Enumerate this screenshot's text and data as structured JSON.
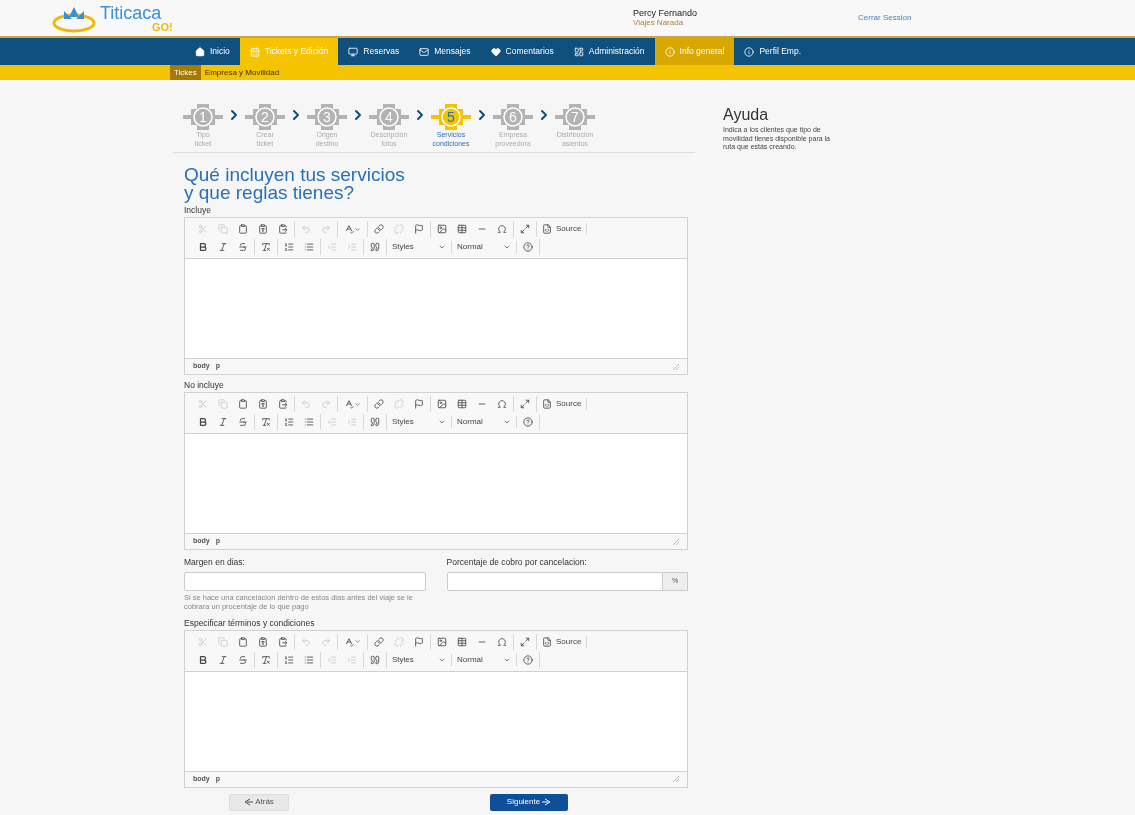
{
  "header": {
    "logo_text": "Titicaca",
    "logo_subtext": "GO!",
    "user_name": "Percy Fernando",
    "user_company": "Viajes Narada",
    "logout": "Cerrar Session"
  },
  "nav": [
    {
      "label": "Inicio",
      "kind": "home",
      "selected": false,
      "highlighted": false
    },
    {
      "label": "Tickets y Edición",
      "kind": "calendar",
      "selected": true,
      "highlighted": false
    },
    {
      "label": "Reservas",
      "kind": "reservas",
      "selected": false,
      "highlighted": false
    },
    {
      "label": "Mensajes",
      "kind": "mail",
      "selected": false,
      "highlighted": false
    },
    {
      "label": "Comentarios",
      "kind": "heart",
      "selected": false,
      "highlighted": false
    },
    {
      "label": "Administración",
      "kind": "admin",
      "selected": false,
      "highlighted": false
    },
    {
      "label": "Info general",
      "kind": "info",
      "selected": false,
      "highlighted": true
    },
    {
      "label": "Perfil Emp.",
      "kind": "info",
      "selected": false,
      "highlighted": false
    }
  ],
  "subnav": [
    {
      "label": "Tickes",
      "selected": true
    },
    {
      "label": "Empresa y Movilidad",
      "selected": false
    }
  ],
  "steps": [
    {
      "number": "1",
      "line1": "Tipo",
      "line2": "ticket",
      "selected": false
    },
    {
      "number": "2",
      "line1": "Crear",
      "line2": "ticket",
      "selected": false
    },
    {
      "number": "3",
      "line1": "Origen",
      "line2": "destino",
      "selected": false
    },
    {
      "number": "4",
      "line1": "Descripción",
      "line2": "fotos",
      "selected": false
    },
    {
      "number": "5",
      "line1": "Servicios",
      "line2": "condiciones",
      "selected": true
    },
    {
      "number": "6",
      "line1": "Empresa",
      "line2": "proveedora",
      "selected": false
    },
    {
      "number": "7",
      "line1": "Distribucion",
      "line2": "asientos",
      "selected": false
    }
  ],
  "title_line1": "Qué incluyen tus servicios",
  "title_line2": "y que reglas tienes?",
  "editors_top": [
    {
      "label": "Incluye",
      "path": [
        "body",
        "p"
      ],
      "toolbar": [
        [
          [
            {
              "kind": "cut",
              "disabled": true
            },
            {
              "kind": "copy",
              "disabled": true
            },
            {
              "kind": "paste",
              "disabled": false
            },
            {
              "kind": "paste-text",
              "disabled": false
            },
            {
              "kind": "paste-word",
              "disabled": false
            }
          ],
          [
            {
              "kind": "undo",
              "disabled": true
            },
            {
              "kind": "redo",
              "disabled": true
            }
          ],
          [
            {
              "kind": "spell",
              "disabled": false
            }
          ],
          [
            {
              "kind": "link",
              "disabled": false
            },
            {
              "kind": "unlink",
              "disabled": true
            },
            {
              "kind": "anchor",
              "disabled": false
            }
          ],
          [
            {
              "kind": "image",
              "disabled": false
            },
            {
              "kind": "table",
              "disabled": false
            },
            {
              "kind": "hr",
              "disabled": false
            },
            {
              "kind": "omega",
              "disabled": false
            }
          ],
          [
            {
              "kind": "maximize",
              "disabled": false
            }
          ],
          [
            {
              "kind": "source",
              "label": "Source",
              "disabled": false
            }
          ]
        ],
        [
          [
            {
              "kind": "bold",
              "disabled": false
            },
            {
              "kind": "italic",
              "disabled": false
            },
            {
              "kind": "strike",
              "disabled": false
            }
          ],
          [
            {
              "kind": "clear-format",
              "disabled": false
            }
          ],
          [
            {
              "kind": "ol",
              "disabled": false
            },
            {
              "kind": "ul",
              "disabled": false
            }
          ],
          [
            {
              "kind": "outdent",
              "disabled": true
            },
            {
              "kind": "indent",
              "disabled": true
            }
          ],
          [
            {
              "kind": "quote",
              "disabled": false
            }
          ],
          [
            {
              "kind": "dropdown",
              "label": "Styles",
              "disabled": false
            }
          ],
          [
            {
              "kind": "dropdown",
              "label": "Normal",
              "disabled": false
            }
          ],
          [
            {
              "kind": "help",
              "disabled": false
            }
          ]
        ]
      ]
    },
    {
      "label": "No incluye",
      "path": [
        "body",
        "p"
      ],
      "toolbar": [
        [
          [
            {
              "kind": "cut",
              "disabled": true
            },
            {
              "kind": "copy",
              "disabled": true
            },
            {
              "kind": "paste",
              "disabled": false
            },
            {
              "kind": "paste-text",
              "disabled": false
            },
            {
              "kind": "paste-word",
              "disabled": false
            }
          ],
          [
            {
              "kind": "undo",
              "disabled": true
            },
            {
              "kind": "redo",
              "disabled": true
            }
          ],
          [
            {
              "kind": "spell",
              "disabled": false
            }
          ],
          [
            {
              "kind": "link",
              "disabled": false
            },
            {
              "kind": "unlink",
              "disabled": true
            },
            {
              "kind": "anchor",
              "disabled": false
            }
          ],
          [
            {
              "kind": "image",
              "disabled": false
            },
            {
              "kind": "table",
              "disabled": false
            },
            {
              "kind": "hr",
              "disabled": false
            },
            {
              "kind": "omega",
              "disabled": false
            }
          ],
          [
            {
              "kind": "maximize",
              "disabled": false
            }
          ],
          [
            {
              "kind": "source",
              "label": "Source",
              "disabled": false
            }
          ]
        ],
        [
          [
            {
              "kind": "bold",
              "disabled": false
            },
            {
              "kind": "italic",
              "disabled": false
            },
            {
              "kind": "strike",
              "disabled": false
            }
          ],
          [
            {
              "kind": "clear-format",
              "disabled": false
            }
          ],
          [
            {
              "kind": "ol",
              "disabled": false
            },
            {
              "kind": "ul",
              "disabled": false
            }
          ],
          [
            {
              "kind": "outdent",
              "disabled": true
            },
            {
              "kind": "indent",
              "disabled": true
            }
          ],
          [
            {
              "kind": "quote",
              "disabled": false
            }
          ],
          [
            {
              "kind": "dropdown",
              "label": "Styles",
              "disabled": false
            }
          ],
          [
            {
              "kind": "dropdown",
              "label": "Normal",
              "disabled": false
            }
          ],
          [
            {
              "kind": "help",
              "disabled": false
            }
          ]
        ]
      ]
    }
  ],
  "margin_field": {
    "label": "Margen en dias:",
    "hint": "Si se hace una cancelacion dentro de estos dias antes del viaje se le cobrara un procentaje de lo que pago"
  },
  "percent_field": {
    "label": "Porcentaje de cobro por cancelacion:",
    "addon": "%"
  },
  "editor_terms": {
    "label": "Especificar términos y condiciones",
    "path": [
      "body",
      "p"
    ],
    "toolbar": [
      [
        [
          {
            "kind": "cut",
            "disabled": true
          },
          {
            "kind": "copy",
            "disabled": true
          },
          {
            "kind": "paste",
            "disabled": false
          },
          {
            "kind": "paste-text",
            "disabled": false
          },
          {
            "kind": "paste-word",
            "disabled": false
          }
        ],
        [
          {
            "kind": "undo",
            "disabled": true
          },
          {
            "kind": "redo",
            "disabled": true
          }
        ],
        [
          {
            "kind": "spell",
            "disabled": false
          }
        ],
        [
          {
            "kind": "link",
            "disabled": false
          },
          {
            "kind": "unlink",
            "disabled": true
          },
          {
            "kind": "anchor",
            "disabled": false
          }
        ],
        [
          {
            "kind": "image",
            "disabled": false
          },
          {
            "kind": "table",
            "disabled": false
          },
          {
            "kind": "hr",
            "disabled": false
          },
          {
            "kind": "omega",
            "disabled": false
          }
        ],
        [
          {
            "kind": "maximize",
            "disabled": false
          }
        ],
        [
          {
            "kind": "source",
            "label": "Source",
            "disabled": false
          }
        ]
      ],
      [
        [
          {
            "kind": "bold",
            "disabled": false
          },
          {
            "kind": "italic",
            "disabled": false
          },
          {
            "kind": "strike",
            "disabled": false
          }
        ],
        [
          {
            "kind": "clear-format",
            "disabled": false
          }
        ],
        [
          {
            "kind": "ol",
            "disabled": false
          },
          {
            "kind": "ul",
            "disabled": false
          }
        ],
        [
          {
            "kind": "outdent",
            "disabled": true
          },
          {
            "kind": "indent",
            "disabled": true
          }
        ],
        [
          {
            "kind": "quote",
            "disabled": false
          }
        ],
        [
          {
            "kind": "dropdown",
            "label": "Styles",
            "disabled": false
          }
        ],
        [
          {
            "kind": "dropdown",
            "label": "Normal",
            "disabled": false
          }
        ],
        [
          {
            "kind": "help",
            "disabled": false
          }
        ]
      ]
    ]
  },
  "buttons": {
    "back": "Atrás",
    "next": "Siguiente"
  },
  "help": {
    "title": "Ayuda",
    "text": "Indica a los clientes que tipo de movilidad tienes disponible para la ruta que estás creando."
  }
}
